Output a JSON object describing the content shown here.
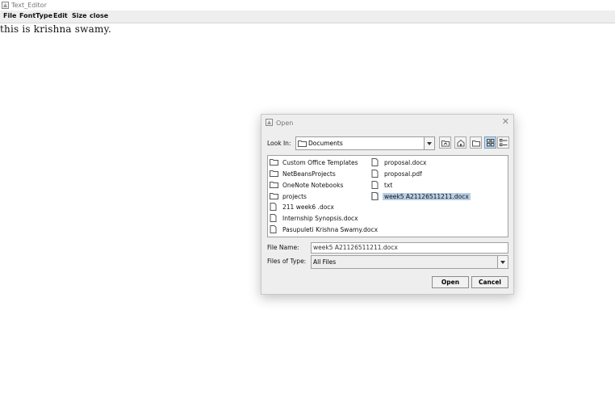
{
  "app": {
    "title": "Text_Editor",
    "menu": [
      "File",
      "FontType",
      "Edit",
      "Size",
      "close"
    ],
    "editor_text": "this is krishna swamy."
  },
  "dialog": {
    "title": "Open",
    "close_glyph": "✕",
    "look_in_label": "Look In:",
    "look_in_value": "Documents",
    "toolbar": [
      "up-one-level-icon",
      "home-icon",
      "new-folder-icon",
      "list-view-icon",
      "details-view-icon"
    ],
    "files": [
      {
        "name": "Custom Office Templates",
        "type": "folder"
      },
      {
        "name": "NetBeansProjects",
        "type": "folder"
      },
      {
        "name": "OneNote Notebooks",
        "type": "folder"
      },
      {
        "name": "projects",
        "type": "folder"
      },
      {
        "name": "211 week6 .docx",
        "type": "file"
      },
      {
        "name": "Internship Synopsis.docx",
        "type": "file"
      },
      {
        "name": "Pasupuleti Krishna Swamy.docx",
        "type": "file"
      },
      {
        "name": "proposal.docx",
        "type": "file"
      },
      {
        "name": "proposal.pdf",
        "type": "file"
      },
      {
        "name": "txt",
        "type": "file"
      },
      {
        "name": "week5 A21126511211.docx",
        "type": "file",
        "selected": true
      }
    ],
    "file_name_label": "File Name:",
    "file_name_value": "week5 A21126511211.docx",
    "file_type_label": "Files of Type:",
    "file_type_value": "All Files",
    "open_label": "Open",
    "cancel_label": "Cancel"
  },
  "colors": {
    "selection": "#b8cfe5",
    "dialog_bg": "#eeeeee",
    "menubar_bg": "#eeeeee"
  }
}
